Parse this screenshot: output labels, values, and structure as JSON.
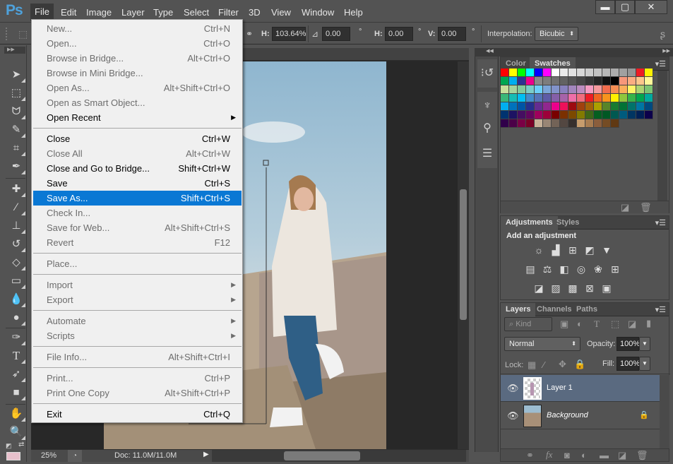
{
  "app": {
    "logo": "Ps"
  },
  "menubar": {
    "items": [
      "File",
      "Edit",
      "Image",
      "Layer",
      "Type",
      "Select",
      "Filter",
      "3D",
      "View",
      "Window",
      "Help"
    ],
    "active": "File",
    "window_controls": {
      "minimize": "▬",
      "maximize": "▢",
      "close": "✕"
    }
  },
  "options_bar": {
    "h_scale_label": "H:",
    "h_scale_value": "103.64%",
    "rotate_value": "0.00",
    "rotate_unit": "°",
    "h_skew_label": "H:",
    "h_skew_value": "0.00",
    "h_skew_unit": "°",
    "v_skew_label": "V:",
    "v_skew_value": "0.00",
    "v_skew_unit": "°",
    "interpolation_label": "Interpolation:",
    "interpolation_value": "Bicubic"
  },
  "file_menu": {
    "groups": [
      [
        {
          "label": "New...",
          "shortcut": "Ctrl+N",
          "state": "disabled"
        },
        {
          "label": "Open...",
          "shortcut": "Ctrl+O",
          "state": "disabled"
        },
        {
          "label": "Browse in Bridge...",
          "shortcut": "Alt+Ctrl+O",
          "state": "disabled"
        },
        {
          "label": "Browse in Mini Bridge...",
          "shortcut": "",
          "state": "disabled"
        },
        {
          "label": "Open As...",
          "shortcut": "Alt+Shift+Ctrl+O",
          "state": "disabled"
        },
        {
          "label": "Open as Smart Object...",
          "shortcut": "",
          "state": "disabled"
        },
        {
          "label": "Open Recent",
          "shortcut": "",
          "state": "enabled",
          "submenu": true
        }
      ],
      [
        {
          "label": "Close",
          "shortcut": "Ctrl+W",
          "state": "enabled"
        },
        {
          "label": "Close All",
          "shortcut": "Alt+Ctrl+W",
          "state": "disabled"
        },
        {
          "label": "Close and Go to Bridge...",
          "shortcut": "Shift+Ctrl+W",
          "state": "enabled"
        },
        {
          "label": "Save",
          "shortcut": "Ctrl+S",
          "state": "enabled"
        },
        {
          "label": "Save As...",
          "shortcut": "Shift+Ctrl+S",
          "state": "selected"
        },
        {
          "label": "Check In...",
          "shortcut": "",
          "state": "disabled"
        },
        {
          "label": "Save for Web...",
          "shortcut": "Alt+Shift+Ctrl+S",
          "state": "disabled"
        },
        {
          "label": "Revert",
          "shortcut": "F12",
          "state": "disabled"
        }
      ],
      [
        {
          "label": "Place...",
          "shortcut": "",
          "state": "disabled"
        }
      ],
      [
        {
          "label": "Import",
          "shortcut": "",
          "state": "disabled",
          "submenu": true
        },
        {
          "label": "Export",
          "shortcut": "",
          "state": "disabled",
          "submenu": true
        }
      ],
      [
        {
          "label": "Automate",
          "shortcut": "",
          "state": "disabled",
          "submenu": true
        },
        {
          "label": "Scripts",
          "shortcut": "",
          "state": "disabled",
          "submenu": true
        }
      ],
      [
        {
          "label": "File Info...",
          "shortcut": "Alt+Shift+Ctrl+I",
          "state": "disabled"
        }
      ],
      [
        {
          "label": "Print...",
          "shortcut": "Ctrl+P",
          "state": "disabled"
        },
        {
          "label": "Print One Copy",
          "shortcut": "Alt+Shift+Ctrl+P",
          "state": "disabled"
        }
      ],
      [
        {
          "label": "Exit",
          "shortcut": "Ctrl+Q",
          "state": "enabled"
        }
      ]
    ]
  },
  "toolbar": {
    "tools": [
      "move-tool",
      "marquee-tool",
      "lasso-tool",
      "quick-selection-tool",
      "crop-tool",
      "eyedropper-tool",
      "healing-brush-tool",
      "brush-tool",
      "clone-stamp-tool",
      "history-brush-tool",
      "eraser-tool",
      "gradient-tool",
      "blur-tool",
      "dodge-tool",
      "pen-tool",
      "type-tool",
      "path-selection-tool",
      "rectangle-tool",
      "hand-tool",
      "zoom-tool"
    ],
    "foreground_color": "#e8c0cc",
    "background_color": "#ffffff"
  },
  "status_bar": {
    "zoom": "25%",
    "doc_info": "Doc: 11.0M/11.0M"
  },
  "swatches_panel": {
    "tabs": [
      "Color",
      "Swatches"
    ],
    "active_tab": "Swatches",
    "colors": [
      [
        "#ff0000",
        "#ffff00",
        "#00ff00",
        "#00ffff",
        "#0000ff",
        "#ff00ff",
        "#ffffff",
        "#ebebeb",
        "#e1e1e1",
        "#d7d7d7",
        "#cccccc",
        "#c2c2c2",
        "#b7b7b7",
        "#acacac",
        "#a0a0a0",
        "#959595",
        "#ee1c24",
        "#fff200"
      ],
      [
        "#00a651",
        "#00aeef",
        "#2e3192",
        "#ec008c",
        "#898989",
        "#7d7d7d",
        "#707070",
        "#626262",
        "#555555",
        "#464646",
        "#363636",
        "#262626",
        "#111111",
        "#000000",
        "#f7977a",
        "#fbad82",
        "#fdc68c",
        "#fff799"
      ],
      [
        "#c6df9c",
        "#a4d49d",
        "#81ca9d",
        "#7bcdc9",
        "#6ccff7",
        "#7ca6d8",
        "#8293ca",
        "#8881be",
        "#a286bd",
        "#bc8cbf",
        "#f49bc1",
        "#f5999d",
        "#f16c4d",
        "#f68e54",
        "#fbaf5a",
        "#fff467",
        "#acd372",
        "#7dc473"
      ],
      [
        "#39b778",
        "#16bcb4",
        "#00bff3",
        "#438ccb",
        "#5573b7",
        "#5e5ca7",
        "#855fa8",
        "#a763a9",
        "#ef6ea8",
        "#f16d7e",
        "#ee1d24",
        "#f16522",
        "#f7941d",
        "#fff100",
        "#8fc63d",
        "#37b44a",
        "#00a650",
        "#00a99e"
      ],
      [
        "#00aeef",
        "#0072bc",
        "#0054a5",
        "#262f8d",
        "#652c91",
        "#91278f",
        "#ed008c",
        "#ee105a",
        "#9d0a0f",
        "#a1410d",
        "#a36209",
        "#aba000",
        "#588528",
        "#197b30",
        "#007236",
        "#00736a",
        "#0076a4",
        "#004a80"
      ],
      [
        "#003370",
        "#1d1363",
        "#450e61",
        "#62055f",
        "#9e005c",
        "#9d0039",
        "#790000",
        "#7b3000",
        "#7c4900",
        "#827a00",
        "#3e6617",
        "#045f20",
        "#005824",
        "#005951",
        "#005b7e",
        "#003562",
        "#002056",
        "#0c004b"
      ],
      [
        "#30004a",
        "#4b0048",
        "#7a0045",
        "#7a0026",
        "#c7b299",
        "#998675",
        "#736357",
        "#534741",
        "#37302d",
        "#c69c6d",
        "#a77c50",
        "#8b5e3c",
        "#754c24",
        "#603913"
      ]
    ]
  },
  "adjustments_panel": {
    "tabs": [
      "Adjustments",
      "Styles"
    ],
    "active_tab": "Adjustments",
    "heading": "Add an adjustment",
    "rows": [
      [
        "brightness-contrast",
        "levels",
        "curves",
        "exposure",
        "vibrance"
      ],
      [
        "hue-saturation",
        "color-balance",
        "black-white",
        "photo-filter",
        "channel-mixer",
        "color-lookup"
      ],
      [
        "invert",
        "posterize",
        "threshold",
        "selective-color",
        "gradient-map"
      ]
    ]
  },
  "layers_panel": {
    "tabs": [
      "Layers",
      "Channels",
      "Paths"
    ],
    "active_tab": "Layers",
    "filter_kind": "Kind",
    "blend_mode": "Normal",
    "opacity_label": "Opacity:",
    "opacity_value": "100%",
    "lock_label": "Lock:",
    "fill_label": "Fill:",
    "fill_value": "100%",
    "layers": [
      {
        "name": "Layer 1",
        "visible": true,
        "selected": true,
        "locked": false
      },
      {
        "name": "Background",
        "visible": true,
        "selected": false,
        "locked": true
      }
    ]
  }
}
